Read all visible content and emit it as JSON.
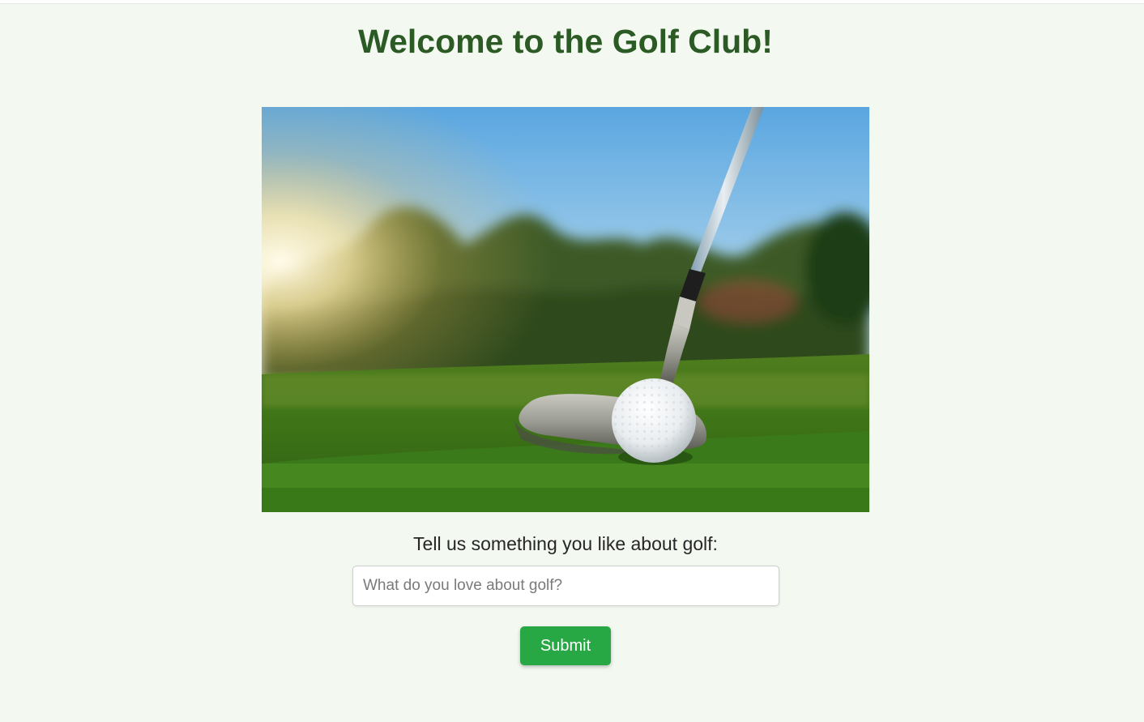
{
  "page": {
    "title": "Welcome to the Golf Club!"
  },
  "hero": {
    "image_subject": "golf-putter-and-ball-on-green"
  },
  "form": {
    "prompt_label": "Tell us something you like about golf:",
    "input_value": "",
    "input_placeholder": "What do you love about golf?",
    "submit_label": "Submit"
  },
  "colors": {
    "background": "#f3f8f1",
    "title": "#2b5a25",
    "button": "#28a745",
    "button_text": "#ffffff"
  }
}
